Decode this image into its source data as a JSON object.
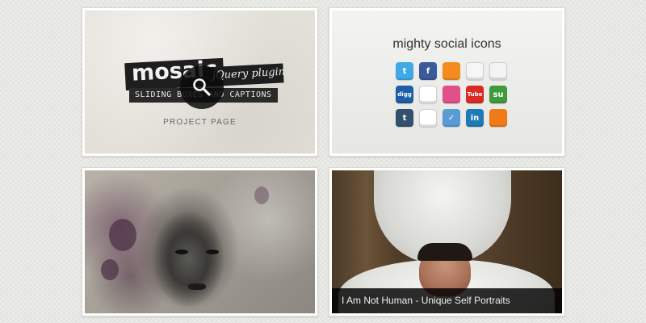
{
  "tiles": {
    "mosaic": {
      "logo_word": "mosaic",
      "logo_suffix": "jQuery plugin",
      "logo_caption": "SLIDING BOXES AND CAPTIONS",
      "link_label": "PROJECT PAGE",
      "icon": "magnifier-icon"
    },
    "social": {
      "title": "mighty social icons",
      "icons": [
        {
          "name": "twitter-icon",
          "glyph": "t",
          "color": "#3fa9e8"
        },
        {
          "name": "facebook-icon",
          "glyph": "f",
          "color": "#3b5a9a"
        },
        {
          "name": "rss-icon",
          "glyph": "",
          "color": "#f48b1e"
        },
        {
          "name": "email-icon",
          "glyph": "",
          "color": "#f6f6f6"
        },
        {
          "name": "email-alt-icon",
          "glyph": "",
          "color": "#f3f3f3"
        },
        {
          "name": "digg-icon",
          "glyph": "digg",
          "color": "#1d5fa6"
        },
        {
          "name": "delicious-icon",
          "glyph": "",
          "color": "#ffffff"
        },
        {
          "name": "dribbble-icon",
          "glyph": "",
          "color": "#e0508a"
        },
        {
          "name": "youtube-icon",
          "glyph": "Tube",
          "color": "#d92b24"
        },
        {
          "name": "stumbleupon-icon",
          "glyph": "su",
          "color": "#3e9a3a"
        },
        {
          "name": "tumblr-icon",
          "glyph": "t",
          "color": "#35506f"
        },
        {
          "name": "flickr-icon",
          "glyph": "",
          "color": "#ffffff"
        },
        {
          "name": "myspace-icon",
          "glyph": "✓",
          "color": "#5b9bd5"
        },
        {
          "name": "linkedin-icon",
          "glyph": "in",
          "color": "#1f7bb6"
        },
        {
          "name": "stumble-orange-icon",
          "glyph": "",
          "color": "#f07a16"
        }
      ]
    },
    "portrait": {
      "image": "ink-portrait-artwork"
    },
    "toilet": {
      "image": "man-in-toilet-photo",
      "caption": "I Am Not Human - Unique Self Portraits"
    }
  }
}
